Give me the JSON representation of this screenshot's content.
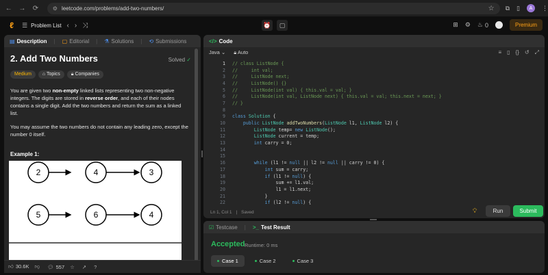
{
  "browser": {
    "url": "leetcode.com/problems/add-two-numbers/"
  },
  "topbar": {
    "problem_list": "Problem List",
    "streak": "0",
    "premium": "Premium"
  },
  "left_tabs": [
    "Description",
    "Editorial",
    "Solutions",
    "Submissions"
  ],
  "problem": {
    "title": "2. Add Two Numbers",
    "solved": "Solved",
    "tags": [
      "Medium",
      "Topics",
      "Companies"
    ],
    "desc1_a": "You are given two ",
    "desc1_b": "non-empty",
    "desc1_c": " linked lists representing two non-negative integers. The digits are stored in ",
    "desc1_d": "reverse order",
    "desc1_e": ", and each of their nodes contains a single digit. Add the two numbers and return the sum as a linked list.",
    "desc2": "You may assume the two numbers do not contain any leading zero, except the number 0 itself.",
    "example": "Example 1:",
    "list1": [
      "2",
      "4",
      "3"
    ],
    "list2": [
      "5",
      "6",
      "4"
    ]
  },
  "left_footer": {
    "likes": "30.6K",
    "comments": "557"
  },
  "code_panel": {
    "tab": "Code",
    "language": "Java",
    "mode": "Auto",
    "status": "Ln 1, Col 1",
    "saved": "Saved",
    "lines": [
      {
        "n": "1",
        "t": "// class ListNode {",
        "c": "comment"
      },
      {
        "n": "2",
        "t": "//     int val;",
        "c": "comment"
      },
      {
        "n": "3",
        "t": "//     ListNode next;",
        "c": "comment"
      },
      {
        "n": "4",
        "t": "//     ListNode() {}",
        "c": "comment"
      },
      {
        "n": "5",
        "t": "//     ListNode(int val) { this.val = val; }",
        "c": "comment"
      },
      {
        "n": "6",
        "t": "//     ListNode(int val, ListNode next) { this.val = val; this.next = next; }",
        "c": "comment"
      },
      {
        "n": "7",
        "t": "// }",
        "c": "comment"
      },
      {
        "n": "8",
        "t": "",
        "c": "plain"
      },
      {
        "n": "9",
        "t": "class Solution {",
        "c": "code"
      },
      {
        "n": "10",
        "t": "    public ListNode addTwoNumbers(ListNode l1, ListNode l2) {",
        "c": "code"
      },
      {
        "n": "11",
        "t": "        ListNode temp= new ListNode();",
        "c": "code"
      },
      {
        "n": "12",
        "t": "        ListNode current = temp;",
        "c": "code"
      },
      {
        "n": "13",
        "t": "        int carry = 0;",
        "c": "code"
      },
      {
        "n": "14",
        "t": "",
        "c": "plain"
      },
      {
        "n": "15",
        "t": "",
        "c": "plain"
      },
      {
        "n": "16",
        "t": "        while (l1 != null || l2 != null || carry != 0) {",
        "c": "code"
      },
      {
        "n": "17",
        "t": "            int sum = carry;",
        "c": "code"
      },
      {
        "n": "18",
        "t": "            if (l1 != null) {",
        "c": "code"
      },
      {
        "n": "19",
        "t": "                sum += l1.val;",
        "c": "code"
      },
      {
        "n": "20",
        "t": "                l1 = l1.next;",
        "c": "code"
      },
      {
        "n": "21",
        "t": "            }",
        "c": "code"
      },
      {
        "n": "22",
        "t": "            if (l2 != null) {",
        "c": "code"
      }
    ],
    "run": "Run",
    "submit": "Submit"
  },
  "test_panel": {
    "tabs": [
      "Testcase",
      "Test Result"
    ],
    "result": "Accepted",
    "runtime": "Runtime: 0 ms",
    "cases": [
      "Case 1",
      "Case 2",
      "Case 3"
    ]
  },
  "colors": {
    "accent": "#ffa116",
    "green": "#2cbb5d",
    "comment": "#6a9955",
    "keyword": "#569cd6",
    "type": "#4ec9b0",
    "func": "#dcdcaa"
  }
}
